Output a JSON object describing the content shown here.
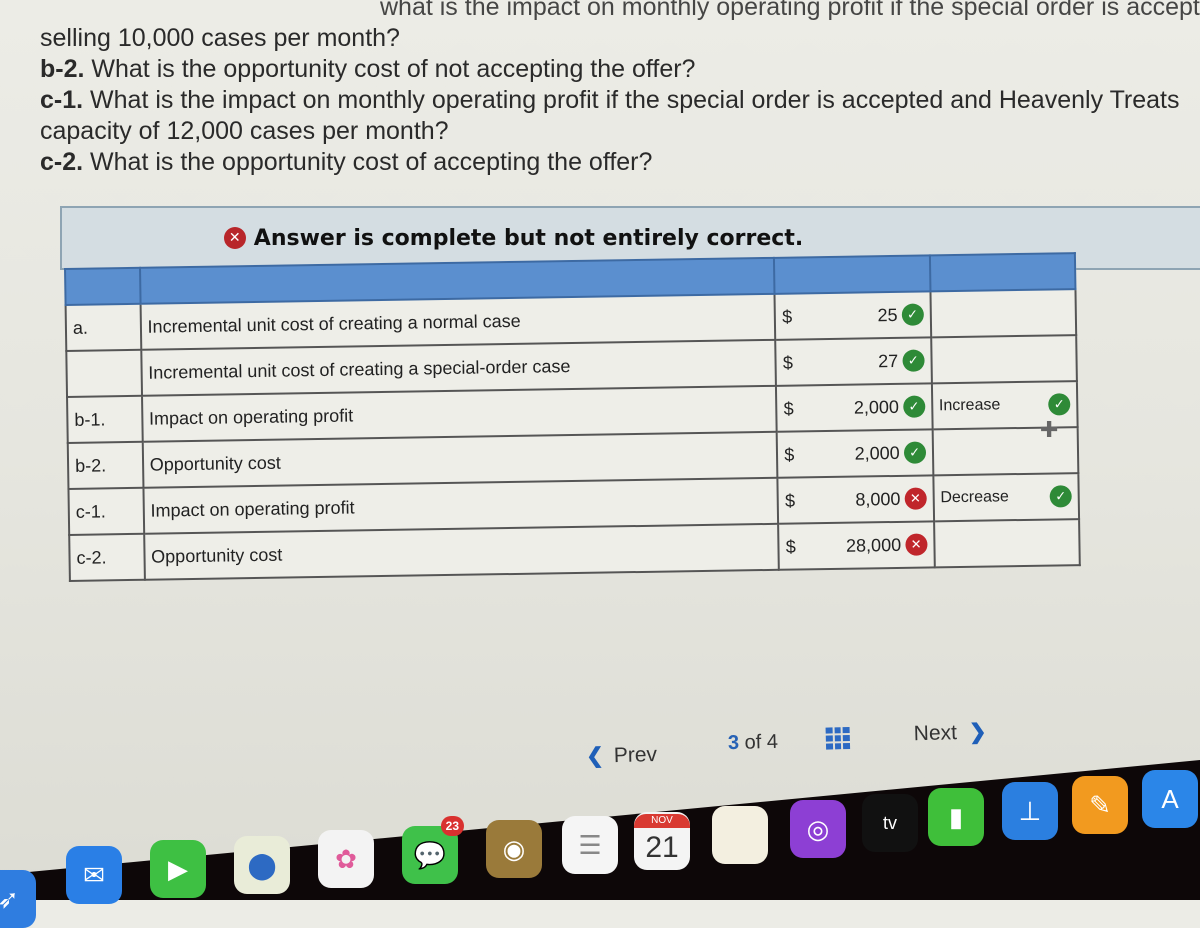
{
  "questions": {
    "cut_line": "what is the impact on monthly operating profit if the special order is accepted and Heavenly Treat",
    "line1": "selling 10,000 cases per month?",
    "b2_label": "b-2.",
    "b2_text": " What is the opportunity cost of not accepting the offer?",
    "c1_label": "c-1.",
    "c1_text": " What is the impact on monthly operating profit if the special order is accepted and Heavenly Treats",
    "c1_cont": "capacity of 12,000 cases per month?",
    "c2_label": "c-2.",
    "c2_text": " What is the opportunity cost of accepting the offer?"
  },
  "feedback": {
    "icon": "x-circle-icon",
    "text": "Answer is complete but not entirely correct."
  },
  "table": {
    "rows": [
      {
        "code": "a.",
        "label": "Incremental unit cost of creating a normal case",
        "currency": "$",
        "amount": "25",
        "amount_status": "correct",
        "direction": "",
        "direction_status": ""
      },
      {
        "code": "",
        "label": "Incremental unit cost of creating a special-order case",
        "currency": "$",
        "amount": "27",
        "amount_status": "correct",
        "direction": "",
        "direction_status": ""
      },
      {
        "code": "b-1.",
        "label": "Impact on operating profit",
        "currency": "$",
        "amount": "2,000",
        "amount_status": "correct",
        "direction": "Increase",
        "direction_status": "correct"
      },
      {
        "code": "b-2.",
        "label": "Opportunity cost",
        "currency": "$",
        "amount": "2,000",
        "amount_status": "correct",
        "direction": "",
        "direction_status": ""
      },
      {
        "code": "c-1.",
        "label": "Impact on operating profit",
        "currency": "$",
        "amount": "8,000",
        "amount_status": "incorrect",
        "direction": "Decrease",
        "direction_status": "correct"
      },
      {
        "code": "c-2.",
        "label": "Opportunity cost",
        "currency": "$",
        "amount": "28,000",
        "amount_status": "incorrect",
        "direction": "",
        "direction_status": ""
      }
    ],
    "check_glyph": "✓",
    "x_glyph": "✕"
  },
  "pager": {
    "prev_label": "Prev",
    "current": "3",
    "of_label": "of",
    "total": "4",
    "next_label": "Next"
  },
  "dock": {
    "messages_badge": "23",
    "calendar_month": "NOV",
    "calendar_day": "21",
    "tv_label": "tv",
    "apps": [
      "Safari",
      "Mail",
      "FaceTime",
      "Maps",
      "Photos",
      "Messages",
      "Contacts",
      "Reminders",
      "Calendar",
      "Notes",
      "Podcasts",
      "TV",
      "Numbers",
      "Keynote",
      "Pages",
      "App Store"
    ]
  }
}
